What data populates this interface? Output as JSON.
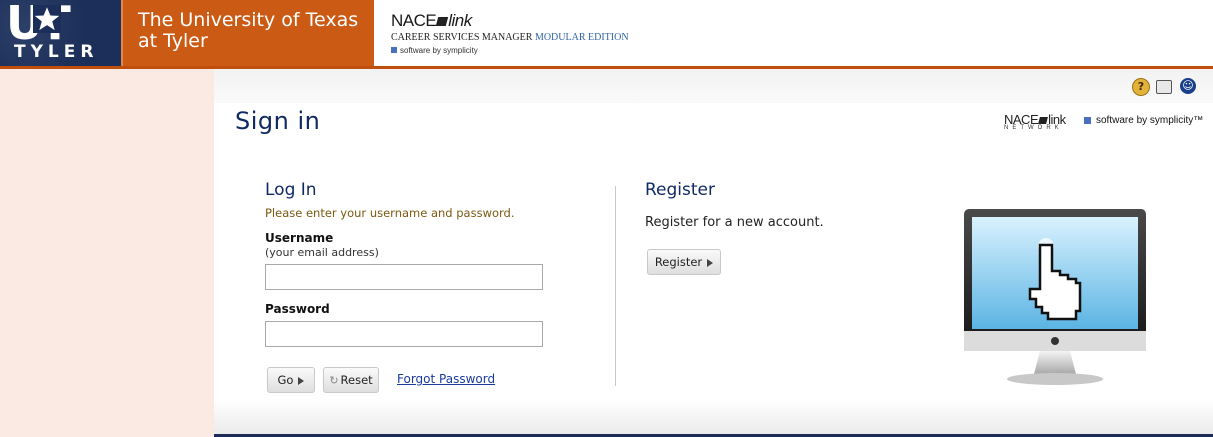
{
  "header": {
    "logo_text": "UT",
    "logo_sub": "TYLER",
    "university_line1": "The University of Texas",
    "university_line2": "at Tyler",
    "nace_logo": "NACE",
    "nace_logo_link": "link",
    "csm_title": "CAREER SERVICES MANAGER",
    "csm_edition": "MODULAR EDITION",
    "software_by": "software by symplicity"
  },
  "toolbar": {
    "help_icon": "help-icon",
    "print_icon": "print-icon",
    "accessibility_icon": "accessibility-icon"
  },
  "page": {
    "title": "Sign in",
    "network_top": "NACE",
    "network_top_link": "link",
    "network_bottom": "NETWORK",
    "software_by": "software by symplicity™"
  },
  "login": {
    "title": "Log In",
    "hint": "Please enter your username and password.",
    "username_label": "Username",
    "username_sub": "(your email address)",
    "username_value": "",
    "password_label": "Password",
    "password_value": "",
    "go_label": "Go",
    "reset_label": "Reset",
    "forgot_label": "Forgot Password"
  },
  "register": {
    "title": "Register",
    "text": "Register for a new account.",
    "button_label": "Register"
  },
  "colors": {
    "navy": "#102a63",
    "orange": "#cb5a14",
    "pink_bg": "#fbeae3",
    "hint": "#7a5a12"
  }
}
